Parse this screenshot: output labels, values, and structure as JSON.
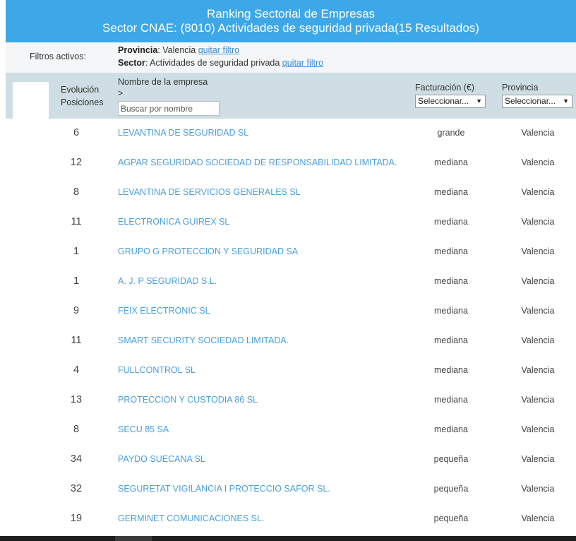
{
  "banner": {
    "title": "Ranking Sectorial de Empresas",
    "subtitle": "Sector CNAE: (8010) Actividades de seguridad privada(15 Resultados)",
    "bg_color": "#3da8e8"
  },
  "filters": {
    "label": "Filtros activos:",
    "provincia_key": "Provincia",
    "provincia_value": ": Valencia ",
    "provincia_remove": "quitar filtro ",
    "sector_key": "Sector",
    "sector_value": ": Actividades de seguridad privada ",
    "sector_remove": "quitar filtro"
  },
  "table_header": {
    "evolucion_line1": "Evolución",
    "evolucion_line2": "Posiciones",
    "nombre_label": "Nombre de la empresa",
    "nombre_sort": ">",
    "search_placeholder": "Buscar por nombre",
    "facturacion_label": "Facturación (€)",
    "facturacion_select": "Seleccionar...",
    "provincia_label": "Provincia",
    "provincia_select": "Seleccionar...",
    "dropdown_icon": "triangle-down-icon",
    "bg_color": "#cfdde4"
  },
  "rows": [
    {
      "rank": "6",
      "name": "LEVANTINA DE SEGURIDAD SL",
      "size": "grande",
      "province": "Valencia"
    },
    {
      "rank": "12",
      "name": "AGPAR SEGURIDAD SOCIEDAD DE RESPONSABILIDAD LIMITADA.",
      "size": "mediana",
      "province": "Valencia"
    },
    {
      "rank": "8",
      "name": "LEVANTINA DE SERVICIOS GENERALES SL",
      "size": "mediana",
      "province": "Valencia"
    },
    {
      "rank": "11",
      "name": "ELECTRONICA GUIREX SL",
      "size": "mediana",
      "province": "Valencia"
    },
    {
      "rank": "1",
      "name": "GRUPO G PROTECCION Y SEGURIDAD SA",
      "size": "mediana",
      "province": "Valencia"
    },
    {
      "rank": "1",
      "name": "A. J. P SEGURIDAD S.L.",
      "size": "mediana",
      "province": "Valencia"
    },
    {
      "rank": "9",
      "name": "FEIX ELECTRONIC SL",
      "size": "mediana",
      "province": "Valencia"
    },
    {
      "rank": "11",
      "name": "SMART SECURITY SOCIEDAD LIMITADA.",
      "size": "mediana",
      "province": "Valencia"
    },
    {
      "rank": "4",
      "name": "FULLCONTROL SL",
      "size": "mediana",
      "province": "Valencia"
    },
    {
      "rank": "13",
      "name": "PROTECCION Y CUSTODIA 86 SL",
      "size": "mediana",
      "province": "Valencia"
    },
    {
      "rank": "8",
      "name": "SECU 85 SA",
      "size": "mediana",
      "province": "Valencia"
    },
    {
      "rank": "34",
      "name": "PAYDO SUECANA SL",
      "size": "pequeña",
      "province": "Valencia"
    },
    {
      "rank": "32",
      "name": "SEGURETAT VIGILANCIA I PROTECCIO SAFOR SL.",
      "size": "pequeña",
      "province": "Valencia"
    },
    {
      "rank": "19",
      "name": "GERMINET COMUNICACIONES SL.",
      "size": "pequeña",
      "province": "Valencia"
    }
  ],
  "colors": {
    "link": "#4a9fd8",
    "filter_link": "#3b8fd4"
  }
}
